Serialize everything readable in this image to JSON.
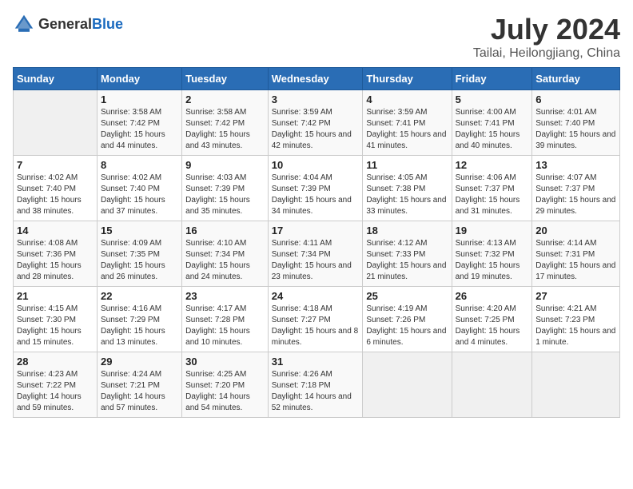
{
  "header": {
    "logo_general": "General",
    "logo_blue": "Blue",
    "title": "July 2024",
    "subtitle": "Tailai, Heilongjiang, China"
  },
  "weekdays": [
    "Sunday",
    "Monday",
    "Tuesday",
    "Wednesday",
    "Thursday",
    "Friday",
    "Saturday"
  ],
  "weeks": [
    [
      {
        "day": "",
        "sunrise": "",
        "sunset": "",
        "daylight": ""
      },
      {
        "day": "1",
        "sunrise": "Sunrise: 3:58 AM",
        "sunset": "Sunset: 7:42 PM",
        "daylight": "Daylight: 15 hours and 44 minutes."
      },
      {
        "day": "2",
        "sunrise": "Sunrise: 3:58 AM",
        "sunset": "Sunset: 7:42 PM",
        "daylight": "Daylight: 15 hours and 43 minutes."
      },
      {
        "day": "3",
        "sunrise": "Sunrise: 3:59 AM",
        "sunset": "Sunset: 7:42 PM",
        "daylight": "Daylight: 15 hours and 42 minutes."
      },
      {
        "day": "4",
        "sunrise": "Sunrise: 3:59 AM",
        "sunset": "Sunset: 7:41 PM",
        "daylight": "Daylight: 15 hours and 41 minutes."
      },
      {
        "day": "5",
        "sunrise": "Sunrise: 4:00 AM",
        "sunset": "Sunset: 7:41 PM",
        "daylight": "Daylight: 15 hours and 40 minutes."
      },
      {
        "day": "6",
        "sunrise": "Sunrise: 4:01 AM",
        "sunset": "Sunset: 7:40 PM",
        "daylight": "Daylight: 15 hours and 39 minutes."
      }
    ],
    [
      {
        "day": "7",
        "sunrise": "Sunrise: 4:02 AM",
        "sunset": "Sunset: 7:40 PM",
        "daylight": "Daylight: 15 hours and 38 minutes."
      },
      {
        "day": "8",
        "sunrise": "Sunrise: 4:02 AM",
        "sunset": "Sunset: 7:40 PM",
        "daylight": "Daylight: 15 hours and 37 minutes."
      },
      {
        "day": "9",
        "sunrise": "Sunrise: 4:03 AM",
        "sunset": "Sunset: 7:39 PM",
        "daylight": "Daylight: 15 hours and 35 minutes."
      },
      {
        "day": "10",
        "sunrise": "Sunrise: 4:04 AM",
        "sunset": "Sunset: 7:39 PM",
        "daylight": "Daylight: 15 hours and 34 minutes."
      },
      {
        "day": "11",
        "sunrise": "Sunrise: 4:05 AM",
        "sunset": "Sunset: 7:38 PM",
        "daylight": "Daylight: 15 hours and 33 minutes."
      },
      {
        "day": "12",
        "sunrise": "Sunrise: 4:06 AM",
        "sunset": "Sunset: 7:37 PM",
        "daylight": "Daylight: 15 hours and 31 minutes."
      },
      {
        "day": "13",
        "sunrise": "Sunrise: 4:07 AM",
        "sunset": "Sunset: 7:37 PM",
        "daylight": "Daylight: 15 hours and 29 minutes."
      }
    ],
    [
      {
        "day": "14",
        "sunrise": "Sunrise: 4:08 AM",
        "sunset": "Sunset: 7:36 PM",
        "daylight": "Daylight: 15 hours and 28 minutes."
      },
      {
        "day": "15",
        "sunrise": "Sunrise: 4:09 AM",
        "sunset": "Sunset: 7:35 PM",
        "daylight": "Daylight: 15 hours and 26 minutes."
      },
      {
        "day": "16",
        "sunrise": "Sunrise: 4:10 AM",
        "sunset": "Sunset: 7:34 PM",
        "daylight": "Daylight: 15 hours and 24 minutes."
      },
      {
        "day": "17",
        "sunrise": "Sunrise: 4:11 AM",
        "sunset": "Sunset: 7:34 PM",
        "daylight": "Daylight: 15 hours and 23 minutes."
      },
      {
        "day": "18",
        "sunrise": "Sunrise: 4:12 AM",
        "sunset": "Sunset: 7:33 PM",
        "daylight": "Daylight: 15 hours and 21 minutes."
      },
      {
        "day": "19",
        "sunrise": "Sunrise: 4:13 AM",
        "sunset": "Sunset: 7:32 PM",
        "daylight": "Daylight: 15 hours and 19 minutes."
      },
      {
        "day": "20",
        "sunrise": "Sunrise: 4:14 AM",
        "sunset": "Sunset: 7:31 PM",
        "daylight": "Daylight: 15 hours and 17 minutes."
      }
    ],
    [
      {
        "day": "21",
        "sunrise": "Sunrise: 4:15 AM",
        "sunset": "Sunset: 7:30 PM",
        "daylight": "Daylight: 15 hours and 15 minutes."
      },
      {
        "day": "22",
        "sunrise": "Sunrise: 4:16 AM",
        "sunset": "Sunset: 7:29 PM",
        "daylight": "Daylight: 15 hours and 13 minutes."
      },
      {
        "day": "23",
        "sunrise": "Sunrise: 4:17 AM",
        "sunset": "Sunset: 7:28 PM",
        "daylight": "Daylight: 15 hours and 10 minutes."
      },
      {
        "day": "24",
        "sunrise": "Sunrise: 4:18 AM",
        "sunset": "Sunset: 7:27 PM",
        "daylight": "Daylight: 15 hours and 8 minutes."
      },
      {
        "day": "25",
        "sunrise": "Sunrise: 4:19 AM",
        "sunset": "Sunset: 7:26 PM",
        "daylight": "Daylight: 15 hours and 6 minutes."
      },
      {
        "day": "26",
        "sunrise": "Sunrise: 4:20 AM",
        "sunset": "Sunset: 7:25 PM",
        "daylight": "Daylight: 15 hours and 4 minutes."
      },
      {
        "day": "27",
        "sunrise": "Sunrise: 4:21 AM",
        "sunset": "Sunset: 7:23 PM",
        "daylight": "Daylight: 15 hours and 1 minute."
      }
    ],
    [
      {
        "day": "28",
        "sunrise": "Sunrise: 4:23 AM",
        "sunset": "Sunset: 7:22 PM",
        "daylight": "Daylight: 14 hours and 59 minutes."
      },
      {
        "day": "29",
        "sunrise": "Sunrise: 4:24 AM",
        "sunset": "Sunset: 7:21 PM",
        "daylight": "Daylight: 14 hours and 57 minutes."
      },
      {
        "day": "30",
        "sunrise": "Sunrise: 4:25 AM",
        "sunset": "Sunset: 7:20 PM",
        "daylight": "Daylight: 14 hours and 54 minutes."
      },
      {
        "day": "31",
        "sunrise": "Sunrise: 4:26 AM",
        "sunset": "Sunset: 7:18 PM",
        "daylight": "Daylight: 14 hours and 52 minutes."
      },
      {
        "day": "",
        "sunrise": "",
        "sunset": "",
        "daylight": ""
      },
      {
        "day": "",
        "sunrise": "",
        "sunset": "",
        "daylight": ""
      },
      {
        "day": "",
        "sunrise": "",
        "sunset": "",
        "daylight": ""
      }
    ]
  ]
}
